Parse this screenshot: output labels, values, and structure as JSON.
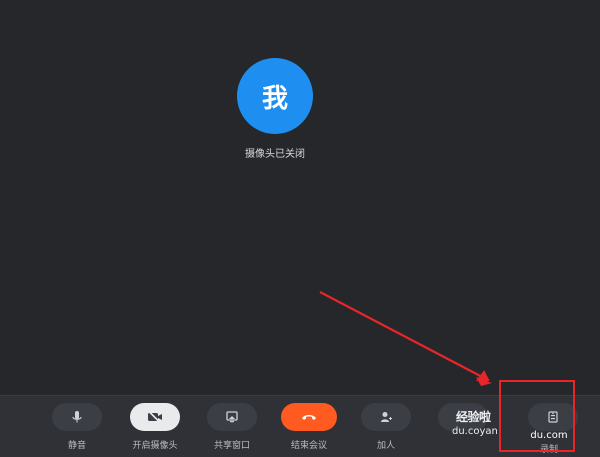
{
  "self_avatar": {
    "text": "我",
    "color": "#1e8ff0"
  },
  "camera_status": "摄像头已关闭",
  "toolbar": {
    "mute": "静音",
    "open_camera": "开启摄像头",
    "share_window": "共享窗口",
    "end_meeting": "结束会议",
    "add_person": "加人",
    "record": "录制"
  },
  "watermark": {
    "top": "经验啦",
    "left_domain": "du.coyan",
    "right_domain": "du.com"
  },
  "colors": {
    "background": "#25272b",
    "toolbar": "#2f3136",
    "end_meeting": "#ff5a1f",
    "highlight": "#e8262a"
  },
  "icons": [
    "microphone-icon",
    "camera-off-icon",
    "share-screen-icon",
    "hang-up-icon",
    "add-person-icon",
    "record-icon"
  ]
}
